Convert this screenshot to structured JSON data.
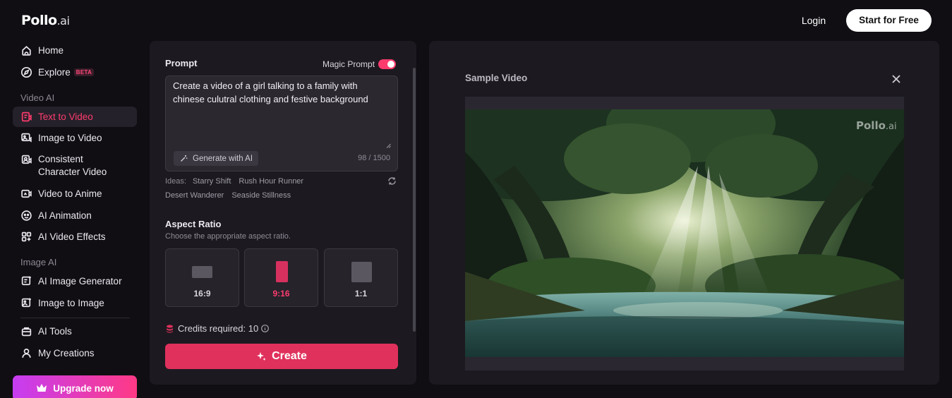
{
  "brand": {
    "name": "Pollo",
    "suffix": ".ai"
  },
  "header": {
    "login": "Login",
    "start": "Start for Free"
  },
  "sidebar": {
    "home": "Home",
    "explore": "Explore",
    "explore_badge": "BETA",
    "section_video": "Video AI",
    "text_to_video": "Text to Video",
    "image_to_video": "Image to Video",
    "consistent": "Consistent\nCharacter Video",
    "video_to_anime": "Video to Anime",
    "ai_animation": "AI Animation",
    "ai_video_effects": "AI Video Effects",
    "section_image": "Image AI",
    "ai_image_generator": "AI Image Generator",
    "image_to_image": "Image to Image",
    "ai_tools": "AI Tools",
    "my_creations": "My Creations",
    "upgrade": "Upgrade now"
  },
  "prompt": {
    "label": "Prompt",
    "magic_label": "Magic Prompt",
    "magic_on": true,
    "text": "Create a video of a girl talking to a family with chinese culutral clothing and festive background",
    "generate": "Generate with AI",
    "counter": "98 / 1500",
    "ideas_label": "Ideas:",
    "ideas": [
      "Starry Shift",
      "Rush Hour Runner",
      "Desert Wanderer",
      "Seaside Stillness"
    ]
  },
  "aspect": {
    "label": "Aspect Ratio",
    "sub": "Choose the appropriate aspect ratio.",
    "options": [
      "16:9",
      "9:16",
      "1:1"
    ],
    "selected": "9:16"
  },
  "credits": {
    "text": "Credits required: 10"
  },
  "create": "Create",
  "sample": {
    "title": "Sample Video",
    "watermark": "Pollo",
    "watermark_suffix": ".ai"
  },
  "colors": {
    "accent": "#e0315c",
    "active_text": "#ff3b6e",
    "bg": "#100e13",
    "panel": "#1c1a20"
  }
}
